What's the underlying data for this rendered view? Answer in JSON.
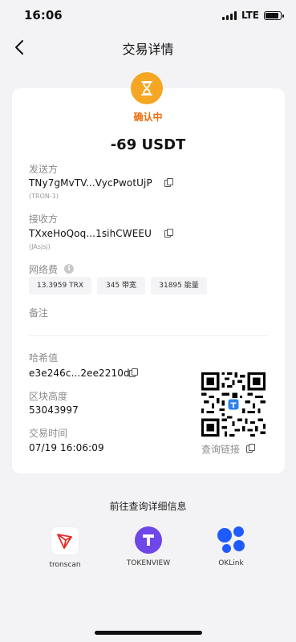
{
  "status_bar": {
    "time": "16:06",
    "network": "LTE"
  },
  "header": {
    "title": "交易详情"
  },
  "tx": {
    "status": "确认中",
    "amount": "-69 USDT",
    "sender_label": "发送方",
    "sender_address": "TNy7gMvTV...VycPwotUjP",
    "sender_sub": "(TRON-1)",
    "receiver_label": "接收方",
    "receiver_address": "TXxeHoQoq...1sihCWEEU",
    "receiver_sub": "(JAsjsj)",
    "fee_label": "网络费",
    "fee_chips": [
      "13.3959 TRX",
      "345 带宽",
      "31895 能量"
    ],
    "memo_label": "备注",
    "hash_label": "哈希值",
    "hash_value": "e3e246c...2ee2210d",
    "block_label": "区块高度",
    "block_value": "53043997",
    "time_label": "交易时间",
    "time_value": "07/19 16:06:09",
    "qr_link_label": "查询链接"
  },
  "explorers": {
    "title": "前往查询详细信息",
    "items": [
      {
        "name": "tronscan",
        "icon": "tronscan-logo"
      },
      {
        "name": "TOKENVIEW",
        "icon": "tokenview-logo"
      },
      {
        "name": "OKLink",
        "icon": "oklink-logo"
      }
    ]
  },
  "colors": {
    "accent_orange": "#ee6a0b",
    "hourglass_bg": "#f5a623",
    "tron_red": "#e62b2b",
    "tokenview_purple": "#6f46e8",
    "oklink_blue": "#1f5bff"
  }
}
